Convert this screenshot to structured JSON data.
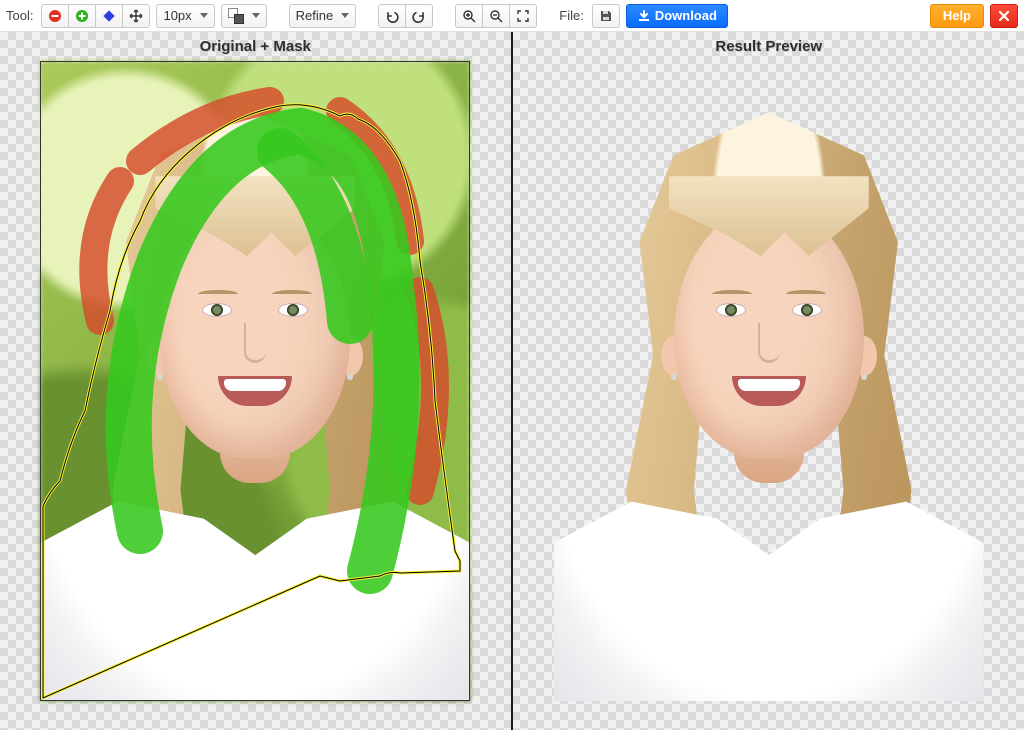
{
  "toolbar": {
    "tool_label": "Tool:",
    "file_label": "File:",
    "brush_size": "10px",
    "refine_label": "Refine",
    "download_label": "Download",
    "help_label": "Help"
  },
  "panels": {
    "left_title": "Original + Mask",
    "right_title": "Result Preview"
  },
  "icons": {
    "remove_bg": "remove-region-circle",
    "keep_fg": "keep-region-circle",
    "eraser_diamond": "eraser-diamond",
    "pan": "pan-cross",
    "color_fgbg": "fg-bg-swatch",
    "refine": "refine",
    "undo": "undo",
    "redo": "redo",
    "zoom_in": "zoom-in",
    "zoom_out": "zoom-out",
    "fit": "fit-screen",
    "save": "save-floppy",
    "download_arrow": "download-arrow",
    "close_x": "close-x"
  },
  "colors": {
    "remove_stroke": "#d64a2b",
    "keep_stroke": "#36c81e",
    "selection_outer": "#f9f13a",
    "selection_inner": "#000000",
    "download_btn": "#0a6cff",
    "help_btn": "#ff9a10",
    "close_btn": "#e62b1b"
  }
}
